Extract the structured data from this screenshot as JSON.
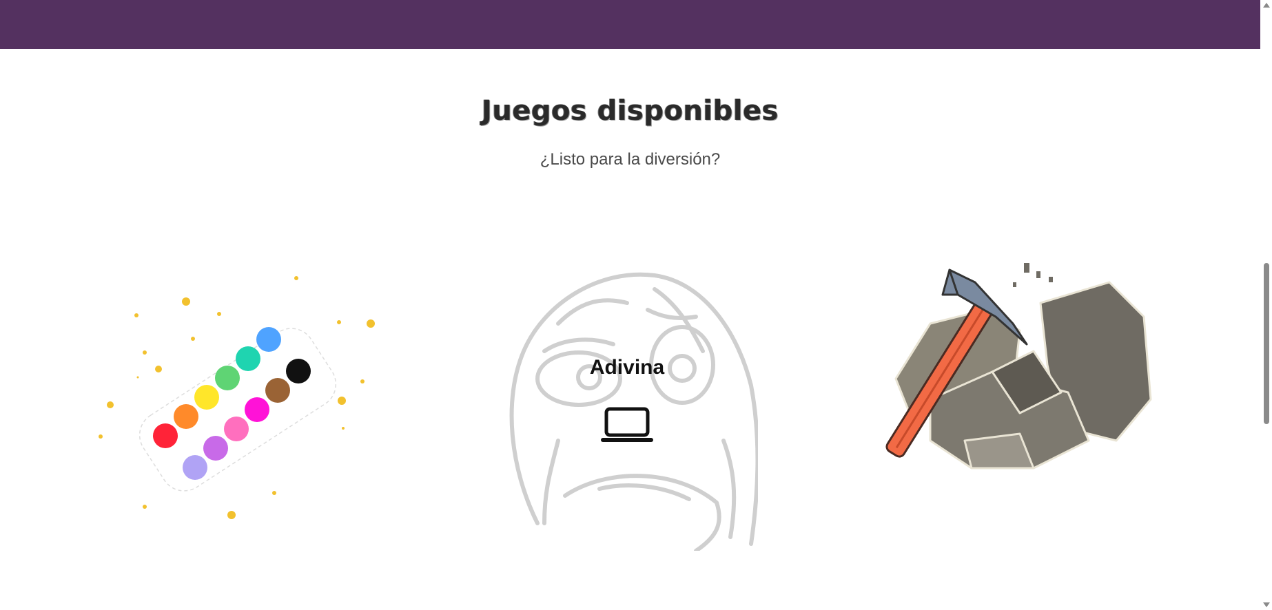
{
  "header": {
    "background": "#543160"
  },
  "section": {
    "title": "Juegos disponibles",
    "subtitle": "¿Listo para la diversión?"
  },
  "games": [
    {
      "id": "colors",
      "image": "paint-palette-image",
      "label": ""
    },
    {
      "id": "guess",
      "image": "rage-face-image",
      "label": "Adivina",
      "icon": "laptop-icon"
    },
    {
      "id": "mining",
      "image": "pickaxe-rocks-image",
      "label": ""
    }
  ],
  "palette_colors": [
    "#ff2338",
    "#ff8a2a",
    "#ffe62a",
    "#5fd474",
    "#1fd4b0",
    "#4fa3ff",
    "#111111",
    "#9a6335",
    "#ff12d7",
    "#ff6fbe",
    "#c86ae8",
    "#b0a3f5"
  ]
}
